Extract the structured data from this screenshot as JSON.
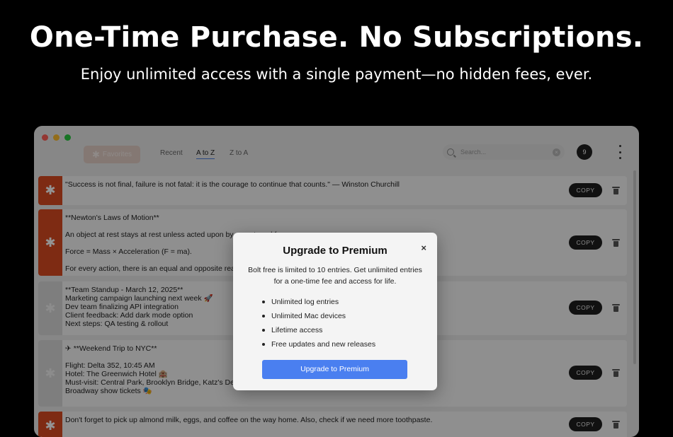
{
  "hero": {
    "title": "One-Time Purchase. No Subscriptions.",
    "subtitle": "Enjoy unlimited access with a single payment—no hidden fees, ever."
  },
  "toolbar": {
    "favorites_label": "Favorites",
    "tabs": [
      {
        "label": "Recent",
        "active": false
      },
      {
        "label": "A to Z",
        "active": true
      },
      {
        "label": "Z to A",
        "active": false
      }
    ],
    "search_placeholder": "Search...",
    "entry_count": "9"
  },
  "entries": [
    {
      "favorite": true,
      "lines": [
        "\"Success is not final, failure is not fatal: it is the courage to continue that counts.\" — Winston Churchill"
      ],
      "copy_label": "COPY"
    },
    {
      "favorite": true,
      "lines": [
        "**Newton's Laws of Motion**",
        "",
        "An object at rest stays at rest unless acted upon by an external force.",
        "",
        "Force = Mass × Acceleration (F = ma).",
        "",
        "For every action, there is an equal and opposite reaction."
      ],
      "copy_label": "COPY"
    },
    {
      "favorite": false,
      "lines": [
        "**Team Standup - March 12, 2025**",
        "Marketing campaign launching next week 🚀",
        "Dev team finalizing API integration",
        "Client feedback: Add dark mode option",
        "Next steps: QA testing & rollout"
      ],
      "copy_label": "COPY"
    },
    {
      "favorite": false,
      "lines": [
        "✈ **Weekend Trip to NYC**",
        "",
        "Flight: Delta 352, 10:45 AM",
        "Hotel: The Greenwich Hotel 🏨",
        "Must-visit: Central Park, Brooklyn Bridge, Katz's Deli",
        "Broadway show tickets 🎭"
      ],
      "copy_label": "COPY"
    },
    {
      "favorite": true,
      "lines": [
        "Don't forget to pick up almond milk, eggs, and coffee on the way home. Also, check if we need more toothpaste."
      ],
      "copy_label": "COPY"
    }
  ],
  "modal": {
    "title": "Upgrade to Premium",
    "close": "×",
    "description": "Bolt free is limited to 10 entries. Get unlimited entries for a one-time fee and access for life.",
    "features": [
      "Unlimited log entries",
      "Unlimited Mac devices",
      "Lifetime access",
      "Free updates and new releases"
    ],
    "cta": "Upgrade to Premium"
  },
  "colors": {
    "accent": "#4a7ff0",
    "favorite_strip": "#d94a22"
  }
}
